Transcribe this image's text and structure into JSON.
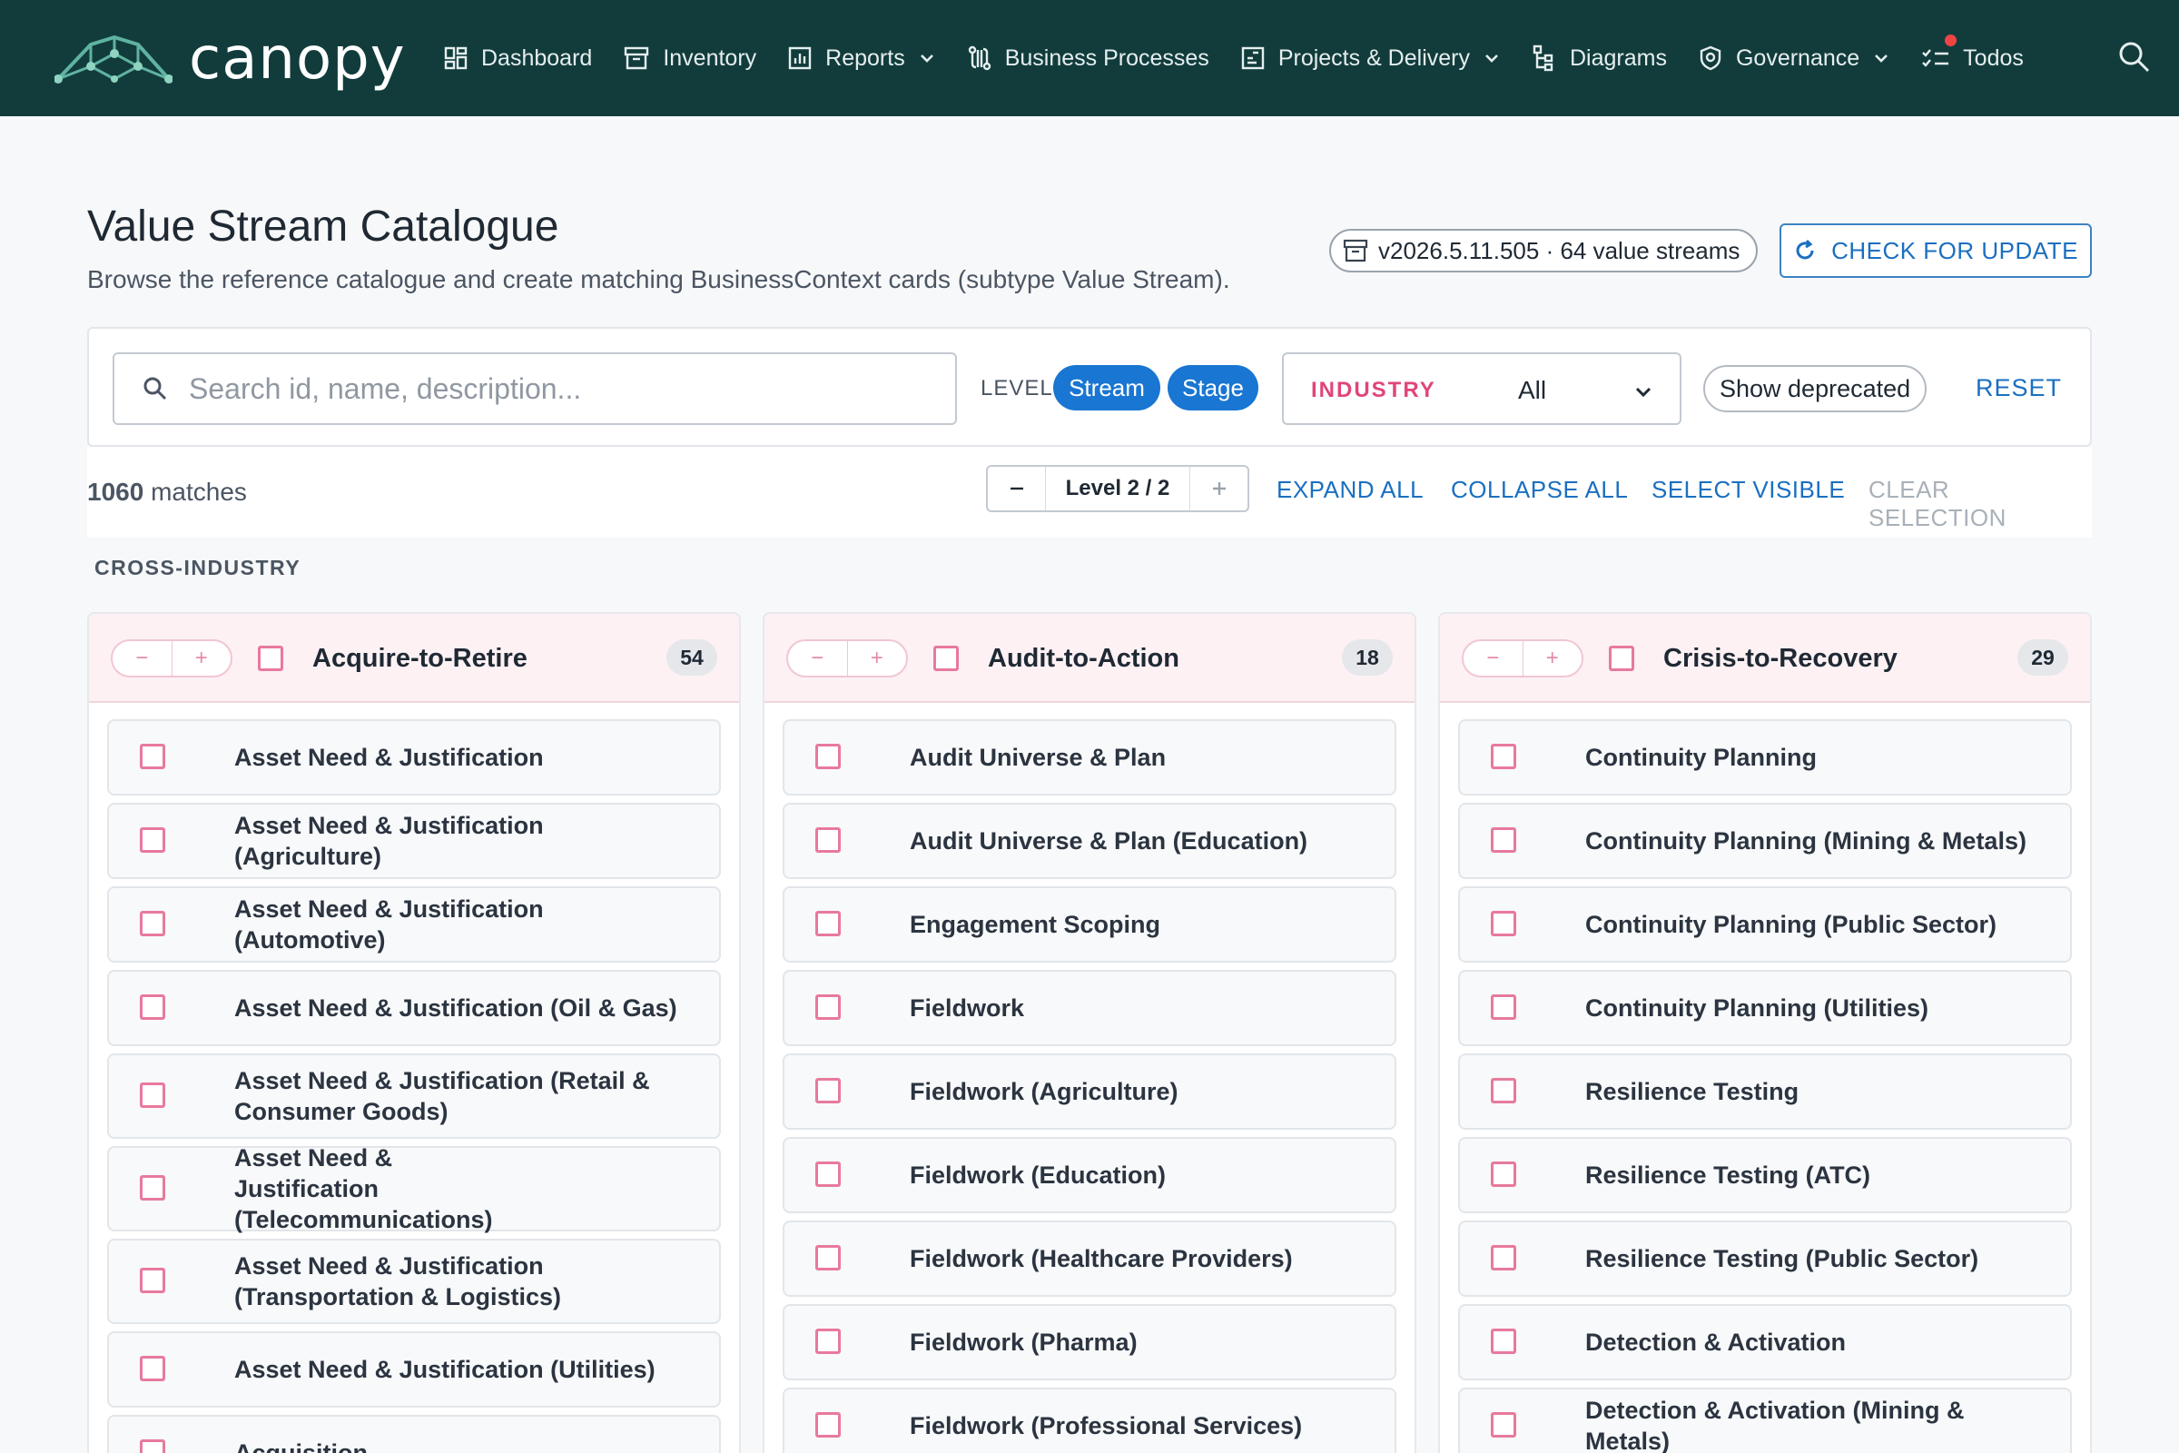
{
  "nav": {
    "brand": "canopy",
    "items": [
      {
        "label": "Dashboard",
        "icon": "dashboard-icon",
        "has_dropdown": false
      },
      {
        "label": "Inventory",
        "icon": "archive-icon",
        "has_dropdown": false
      },
      {
        "label": "Reports",
        "icon": "bar-chart-icon",
        "has_dropdown": true
      },
      {
        "label": "Business Processes",
        "icon": "route-icon",
        "has_dropdown": false
      },
      {
        "label": "Projects & Delivery",
        "icon": "kanban-icon",
        "has_dropdown": true
      },
      {
        "label": "Diagrams",
        "icon": "hierarchy-icon",
        "has_dropdown": false
      },
      {
        "label": "Governance",
        "icon": "shield-icon",
        "has_dropdown": true
      },
      {
        "label": "Todos",
        "icon": "checklist-icon",
        "has_dropdown": false,
        "has_notification": true
      }
    ],
    "search_icon": "search-icon"
  },
  "header": {
    "title": "Value Stream Catalogue",
    "subtitle": "Browse the reference catalogue and create matching BusinessContext cards (subtype Value Stream).",
    "version_chip": "v2026.5.11.505 · 64 value streams",
    "check_update_label": "CHECK FOR UPDATE"
  },
  "filters": {
    "search_placeholder": "Search id, name, description...",
    "search_value": "",
    "level_label": "LEVEL",
    "level_options": [
      "Stream",
      "Stage"
    ],
    "industry_label": "INDUSTRY",
    "industry_value": "All",
    "show_deprecated_label": "Show deprecated",
    "reset_label": "RESET"
  },
  "toolbar": {
    "match_count": "1060",
    "match_suffix": "matches",
    "level_stepper_text": "Level 2 / 2",
    "expand_all": "EXPAND ALL",
    "collapse_all": "COLLAPSE ALL",
    "select_visible": "SELECT VISIBLE",
    "clear_selection": "CLEAR SELECTION"
  },
  "section": {
    "label": "CROSS-INDUSTRY"
  },
  "columns": [
    {
      "title": "Acquire-to-Retire",
      "count": "54",
      "items": [
        "Asset Need & Justification",
        "Asset Need & Justification (Agriculture)",
        "Asset Need & Justification (Automotive)",
        "Asset Need & Justification (Oil & Gas)",
        "Asset Need & Justification (Retail & Consumer Goods)",
        "Asset Need & Justification (Telecommunications)",
        "Asset Need & Justification (Transportation & Logistics)",
        "Asset Need & Justification (Utilities)",
        "Acquisition"
      ]
    },
    {
      "title": "Audit-to-Action",
      "count": "18",
      "items": [
        "Audit Universe & Plan",
        "Audit Universe & Plan (Education)",
        "Engagement Scoping",
        "Fieldwork",
        "Fieldwork (Agriculture)",
        "Fieldwork (Education)",
        "Fieldwork (Healthcare Providers)",
        "Fieldwork (Pharma)",
        "Fieldwork (Professional Services)"
      ]
    },
    {
      "title": "Crisis-to-Recovery",
      "count": "29",
      "items": [
        "Continuity Planning",
        "Continuity Planning (Mining & Metals)",
        "Continuity Planning (Public Sector)",
        "Continuity Planning (Utilities)",
        "Resilience Testing",
        "Resilience Testing (ATC)",
        "Resilience Testing (Public Sector)",
        "Detection & Activation",
        "Detection & Activation (Mining & Metals)"
      ]
    }
  ],
  "colors": {
    "nav_bg": "#123c3c",
    "accent_blue": "#1976d2",
    "accent_pink": "#e8799d",
    "column_header_bg": "#fdf1f4"
  }
}
